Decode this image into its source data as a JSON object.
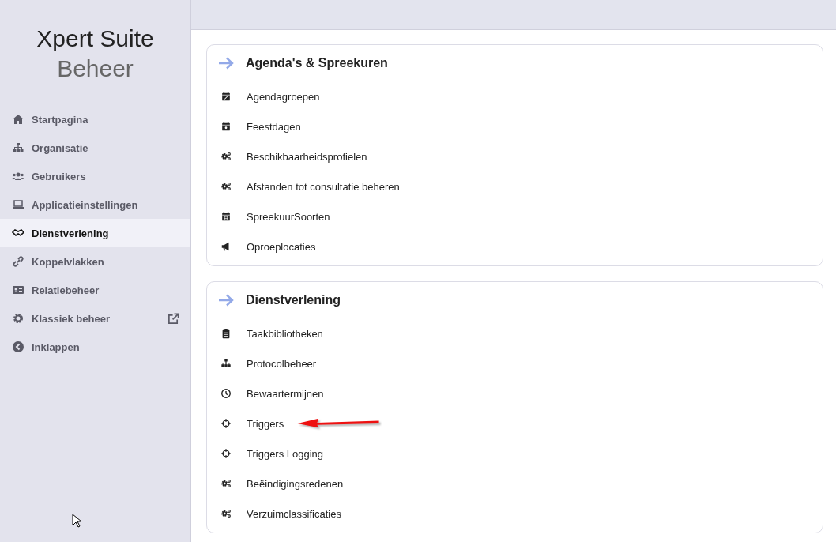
{
  "app_title": {
    "line_1": "Xpert Suite",
    "line_2": "Beheer"
  },
  "sidebar": {
    "items": [
      {
        "label": "Startpagina",
        "selected": false,
        "external": false
      },
      {
        "label": "Organisatie",
        "selected": false,
        "external": false
      },
      {
        "label": "Gebruikers",
        "selected": false,
        "external": false
      },
      {
        "label": "Applicatieinstellingen",
        "selected": false,
        "external": false
      },
      {
        "label": "Dienstverlening",
        "selected": true,
        "external": false
      },
      {
        "label": "Koppelvlakken",
        "selected": false,
        "external": false
      },
      {
        "label": "Relatiebeheer",
        "selected": false,
        "external": false
      },
      {
        "label": "Klassiek beheer",
        "selected": false,
        "external": true
      },
      {
        "label": "Inklappen",
        "selected": false,
        "external": false
      }
    ]
  },
  "sections": [
    {
      "title": "Agenda's & Spreekuren",
      "items": [
        {
          "label": "Agendagroepen"
        },
        {
          "label": "Feestdagen"
        },
        {
          "label": "Beschikbaarheidsprofielen"
        },
        {
          "label": "Afstanden tot consultatie beheren"
        },
        {
          "label": "SpreekuurSoorten"
        },
        {
          "label": "Oproeplocaties"
        }
      ]
    },
    {
      "title": "Dienstverlening",
      "items": [
        {
          "label": "Taakbibliotheken"
        },
        {
          "label": "Protocolbeheer"
        },
        {
          "label": "Bewaartermijnen"
        },
        {
          "label": "Triggers",
          "annotated": true
        },
        {
          "label": "Triggers Logging"
        },
        {
          "label": "Beëindigingsredenen"
        },
        {
          "label": "Verzuimclassificaties"
        }
      ]
    }
  ]
}
